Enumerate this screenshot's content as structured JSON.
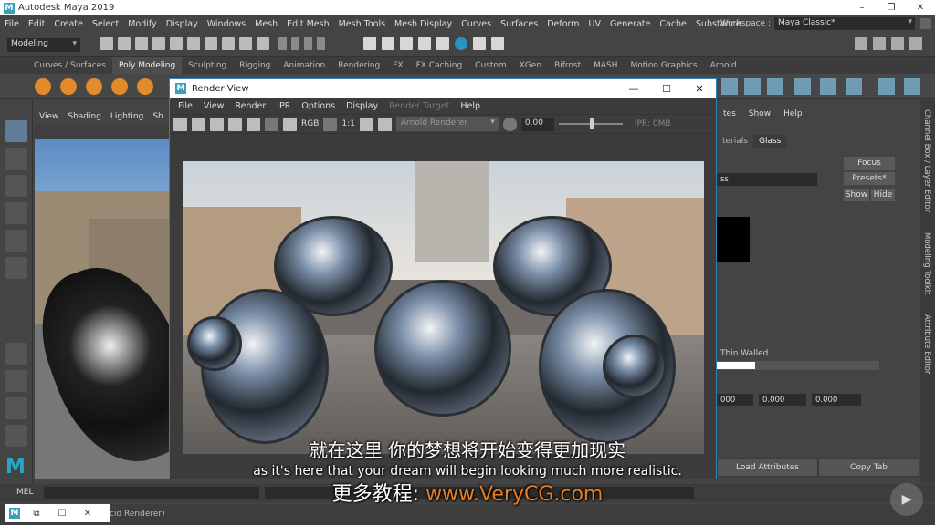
{
  "app": {
    "title": "Autodesk Maya 2019",
    "logo": "M"
  },
  "window_controls": {
    "minimize": "–",
    "maximize": "❐",
    "close": "✕"
  },
  "menubar": [
    "File",
    "Edit",
    "Create",
    "Select",
    "Modify",
    "Display",
    "Windows",
    "Mesh",
    "Edit Mesh",
    "Mesh Tools",
    "Mesh Display",
    "Curves",
    "Surfaces",
    "Deform",
    "UV",
    "Generate",
    "Cache",
    "Substance"
  ],
  "workspace": {
    "label": "Workspace :",
    "value": "Maya Classic*"
  },
  "mode": "Modeling",
  "shelf_tabs": [
    "Curves / Surfaces",
    "Poly Modeling",
    "Sculpting",
    "Rigging",
    "Animation",
    "Rendering",
    "FX",
    "FX Caching",
    "Custom",
    "XGen",
    "Bifrost",
    "MASH",
    "Motion Graphics",
    "Arnold"
  ],
  "shelf_active": "Poly Modeling",
  "viewport_menu": [
    "View",
    "Shading",
    "Lighting",
    "Sh"
  ],
  "render_view": {
    "title": "Render View",
    "menu": [
      "File",
      "View",
      "Render",
      "IPR",
      "Options",
      "Display",
      "Render Target",
      "Help"
    ],
    "disabled_menu": "Render Target",
    "renderer": "Arnold Renderer",
    "ratio": "1:1",
    "rgb": "RGB",
    "exposure": "0.00",
    "ipr_status": "IPR: 0MB",
    "controls": {
      "minimize": "—",
      "maximize": "☐",
      "close": "✕"
    }
  },
  "attribute_editor": {
    "menu": [
      "tes",
      "Show",
      "Help"
    ],
    "tabs": [
      "terials",
      "Glass"
    ],
    "active_tab": "Glass",
    "focus": "Focus",
    "presets": "Presets*",
    "show": "Show",
    "hide": "Hide",
    "name_field": "ss",
    "thin_walled": "Thin Walled",
    "vec": [
      "000",
      "0.000",
      "0.000"
    ],
    "load_attributes": "Load Attributes",
    "copy_tab": "Copy Tab"
  },
  "side_tabs": [
    "Channel Box / Layer Editor",
    "Modeling Toolkit",
    "Attribute Editor"
  ],
  "mel": {
    "label": "MEL"
  },
  "status_hint": "cid Renderer)",
  "subtitles": {
    "chinese": "就在这里 你的梦想将开始变得更加现实",
    "english": "as it's here that your dream will begin looking much more realistic.",
    "promo_prefix": "更多教程:",
    "promo_url": "www.VeryCG.com"
  },
  "taskbar_mini": {
    "logo": "M",
    "restore": "⧉",
    "maximize": "☐",
    "close": "✕"
  },
  "colors": {
    "accent": "#2f81b7",
    "maya_blue": "#3aa0b8",
    "promo_orange": "#e67e22"
  }
}
